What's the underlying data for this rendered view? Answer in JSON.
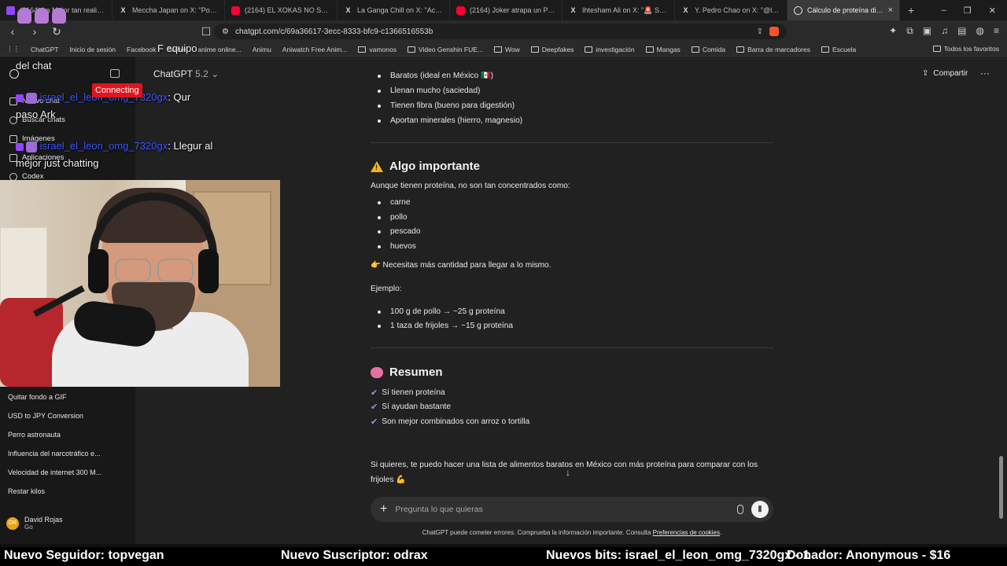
{
  "browser": {
    "tabs": [
      {
        "icon": "twitch",
        "title": "(2164) La Mejor tan realista q",
        "active": false
      },
      {
        "icon": "x",
        "title": "Meccha Japan on X: \"Pokémon",
        "active": false
      },
      {
        "icon": "youtube",
        "title": "(2164) EL XOKAS NO SABE DIV",
        "active": false
      },
      {
        "icon": "x",
        "title": "La Ganga Chill on X: \"Aclarando",
        "active": false
      },
      {
        "icon": "youtube",
        "title": "(2164) Joker atrapa un Pequeñ",
        "active": false
      },
      {
        "icon": "x",
        "title": "Ihtesham Ali on X: \"🚨 Someo",
        "active": false
      },
      {
        "icon": "x",
        "title": "Y. Pedro Chao on X: \"@lunatic",
        "active": false
      },
      {
        "icon": "chatgpt",
        "title": "Cálculo de proteína diaria",
        "active": true
      }
    ],
    "url": "chatgpt.com/c/69a36617-3ecc-8333-bfc9-c1366516553b",
    "bookmarks": [
      "ChatGPT",
      "Inicio de sesión",
      "Facebook",
      "Twitter",
      "anime online...",
      "Animu",
      "Aniwatch Free Anim...",
      "vamonos",
      "Video Genshin FUE...",
      "Wow",
      "Deepfakes",
      "investigación",
      "Mangas",
      "Comida",
      "Barra de marcadores",
      "Escuela"
    ],
    "bookmarks_right": "Todos los favoritos"
  },
  "sidebar": {
    "nav": [
      "Nuevo chat",
      "Buscar chats",
      "Imágenes",
      "Aplicaciones",
      "Codex"
    ],
    "chats": [
      "Quitar fondo a GIF",
      "USD to JPY Conversion",
      "Perro astronauta",
      "Influencia del narcotráfico e...",
      "Velocidad de internet 300 M...",
      "Restar kilos"
    ],
    "user": {
      "initials": "DR",
      "name": "David Rojas",
      "plan": "Go"
    }
  },
  "header": {
    "model": "ChatGPT",
    "version": "5.2",
    "share": "Compartir"
  },
  "content": {
    "bullets_top": [
      "Baratos (ideal en México 🇲🇽)",
      "Llenan mucho (saciedad)",
      "Tienen fibra (bueno para digestión)",
      "Aportan minerales (hierro, magnesio)"
    ],
    "section_important": "Algo importante",
    "important_intro": "Aunque tienen proteína, no son tan concentrados como:",
    "foods": [
      "carne",
      "pollo",
      "pescado",
      "huevos"
    ],
    "need_more": "👉 Necesitas más cantidad para llegar a lo mismo.",
    "example_label": "Ejemplo:",
    "examples": [
      "100 g de pollo → ~25 g proteína",
      "1 taza de frijoles → ~15 g proteína"
    ],
    "section_summary": "Resumen",
    "summary": [
      "Sí tienen proteína",
      "Sí ayudan bastante",
      "Son mejor combinados con arroz o tortilla"
    ],
    "closing_line1": "Si quieres, te puedo hacer una lista de alimentos baratos en México con más proteína para comparar con los",
    "closing_line2": "frijoles 💪"
  },
  "composer": {
    "placeholder": "Pregunta lo que quieras"
  },
  "disclaimer": {
    "text": "ChatGPT puede cometer errores. Comprueba la información importante. Consulta ",
    "link": "Preferencias de cookies",
    "end": "."
  },
  "overlay": {
    "chat_lines": [
      {
        "user": "",
        "text": "F equipo"
      },
      {
        "user": "",
        "text": "del chat"
      },
      {
        "user": "israel_el_leon_omg_7320gx",
        "text": ": Qur"
      },
      {
        "user": "",
        "text": "paso Ark"
      },
      {
        "user": "israel_el_leon_omg_7320gx",
        "text": ": Llegur al"
      },
      {
        "user": "",
        "text": "mejor just chatting"
      }
    ],
    "connecting": "Connecting",
    "ticker": {
      "follower": "Nuevo Seguidor: topvegan",
      "subscriber": "Nuevo Suscriptor: odrax",
      "bits": "Nuevos bits: israel_el_leon_omg_7320gx - 1",
      "donor": "Donador: Anonymous - $16"
    }
  },
  "colors": {
    "accent": "#3b52ff",
    "connecting": "#e0141e",
    "check": "#8e9ce0"
  }
}
